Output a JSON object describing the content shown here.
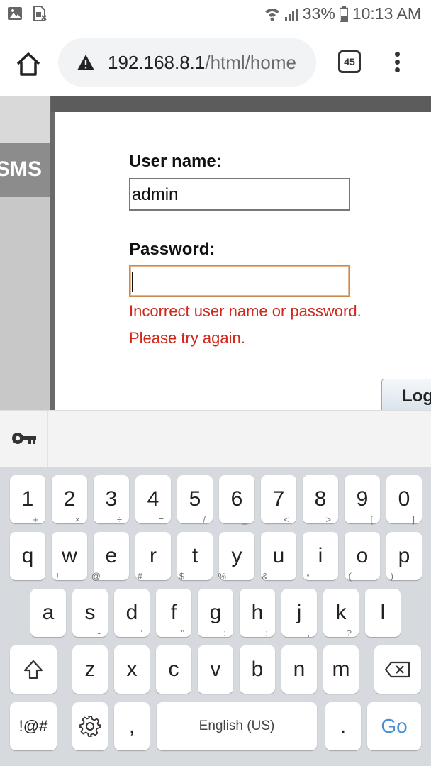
{
  "status_bar": {
    "battery_percent": "33%",
    "time": "10:13 AM"
  },
  "browser": {
    "url_host": "192.168.8.1",
    "url_path": "/html/home",
    "tab_count": "45"
  },
  "page": {
    "side_tab_label": "SMS",
    "username_label": "User name:",
    "username_value": "admin",
    "password_label": "Password:",
    "password_value": "",
    "error_line1": "Incorrect user name or password.",
    "error_line2": "Please try again.",
    "login_button_label": "Log"
  },
  "keyboard": {
    "row_numbers": [
      "1",
      "2",
      "3",
      "4",
      "5",
      "6",
      "7",
      "8",
      "9",
      "0"
    ],
    "row_top": [
      {
        "key": "q",
        "alt": "+"
      },
      {
        "key": "w",
        "alt": "×"
      },
      {
        "key": "e",
        "alt": "÷"
      },
      {
        "key": "r",
        "alt": "="
      },
      {
        "key": "t",
        "alt": "/"
      },
      {
        "key": "y",
        "alt": "_"
      },
      {
        "key": "u",
        "alt": "<"
      },
      {
        "key": "i",
        "alt": ">"
      },
      {
        "key": "o",
        "alt": "["
      },
      {
        "key": "p",
        "alt": "]"
      }
    ],
    "row_middle": [
      {
        "key": "a",
        "alt": "!"
      },
      {
        "key": "s",
        "alt": "@"
      },
      {
        "key": "d",
        "alt": "#"
      },
      {
        "key": "f",
        "alt": "$"
      },
      {
        "key": "g",
        "alt": "%"
      },
      {
        "key": "h",
        "alt": "&"
      },
      {
        "key": "j",
        "alt": "*"
      },
      {
        "key": "k",
        "alt": "("
      },
      {
        "key": "l",
        "alt": ")"
      }
    ],
    "row_bottom": [
      {
        "key": "z",
        "alt": "-"
      },
      {
        "key": "x",
        "alt": "'"
      },
      {
        "key": "c",
        "alt": "\""
      },
      {
        "key": "v",
        "alt": ":"
      },
      {
        "key": "b",
        "alt": ";"
      },
      {
        "key": "n",
        "alt": ","
      },
      {
        "key": "m",
        "alt": "?"
      }
    ],
    "symbols_key": "!@#",
    "comma_key": ",",
    "space_label": "English (US)",
    "period_key": ".",
    "go_label": "Go"
  }
}
